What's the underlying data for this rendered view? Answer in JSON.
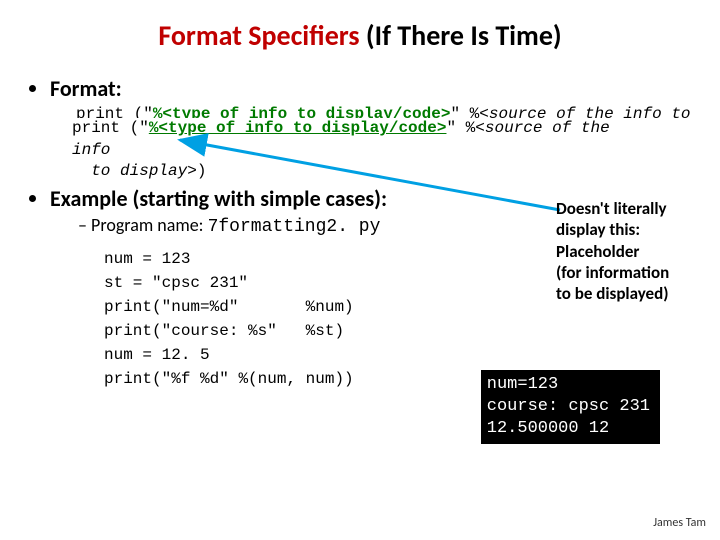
{
  "title": {
    "red": "Format Specifiers",
    "black": "  (If There Is Time)"
  },
  "format_label": "Format:",
  "format_code": {
    "p1": "print (\"",
    "green_ul": "%<type of info to display/code>",
    "p2": "\" %",
    "italic": "<source of the info to display>",
    "p3": ")"
  },
  "example_label": "Example (starting with simple cases):",
  "program_prefix": "Program name: ",
  "program_name": "7formatting2. py",
  "code_lines": {
    "l1": "num = 123",
    "l2": "st = \"cpsc 231\"",
    "l3a": "print(\"num=",
    "l3b": "%d",
    "l3c": "\"       %num)",
    "l4a": "print(\"course: ",
    "l4b": "%s",
    "l4c": "\"   %st)",
    "l5": "num = 12. 5",
    "l6a": "print(\"",
    "l6b": "%f %d",
    "l6c": "\" %(num, num))"
  },
  "annot": {
    "a1": "Doesn't literally",
    "a2": "display this:",
    "a3": "Placeholder",
    "a4": "(for information",
    "a5": "to be displayed)"
  },
  "terminal": {
    "t1": "num=123",
    "t2": "course: cpsc 231",
    "t3": "12.500000 12"
  },
  "footer": "James Tam"
}
